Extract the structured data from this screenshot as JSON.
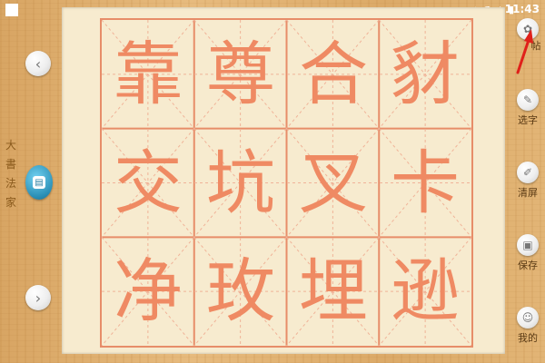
{
  "status_bar": {
    "time": "11:43",
    "icons": [
      "location-icon",
      "wifi-icon",
      "signal-icon",
      "battery-icon"
    ]
  },
  "brand": {
    "chars": [
      "大",
      "書",
      "法",
      "家"
    ]
  },
  "grid": {
    "characters": [
      [
        "靠",
        "尊",
        "合",
        "豺"
      ],
      [
        "交",
        "坑",
        "叉",
        "卡"
      ],
      [
        "净",
        "玫",
        "埋",
        "逊"
      ]
    ]
  },
  "left_nav": {
    "prev_icon": "‹",
    "next_icon": "›",
    "menu_icon": "▤"
  },
  "toolbar": {
    "items": [
      {
        "label": "帖",
        "icon": "seal-icon"
      },
      {
        "label": "选字",
        "icon": "pencil-icon"
      },
      {
        "label": "清屏",
        "icon": "brush-icon"
      },
      {
        "label": "保存",
        "icon": "save-icon"
      },
      {
        "label": "我的",
        "icon": "user-icon"
      }
    ]
  },
  "colors": {
    "grid_line": "#e78d69",
    "character": "#ef8a63",
    "arrow": "#e0201a"
  }
}
